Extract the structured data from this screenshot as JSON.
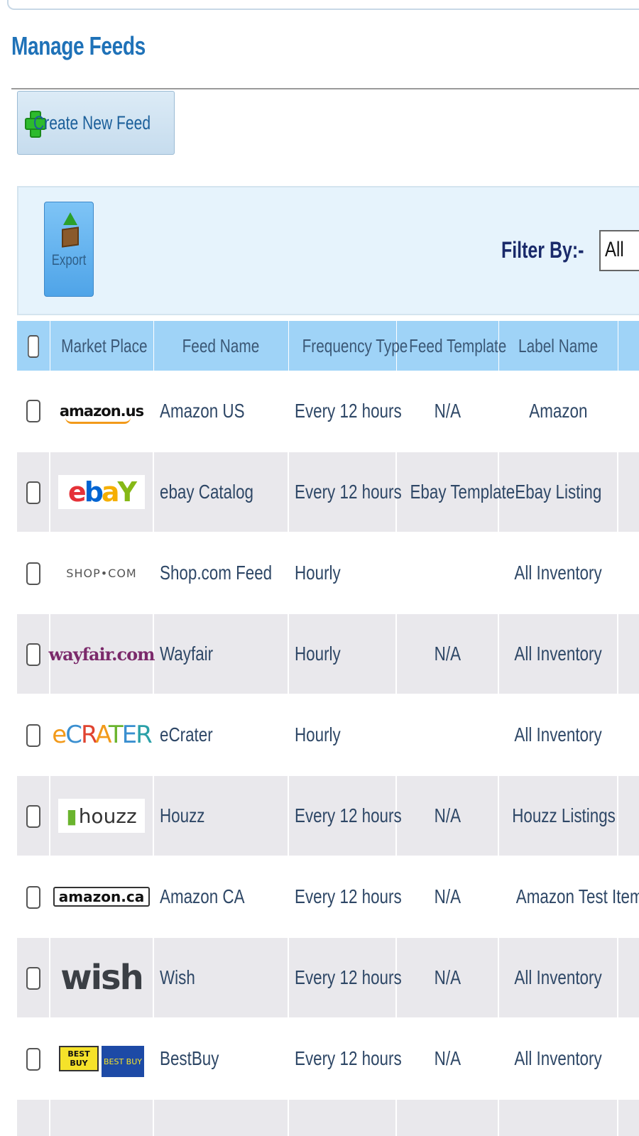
{
  "page": {
    "title": "Manage Feeds"
  },
  "actions": {
    "create_label": "Create New Feed",
    "export_label": "Export"
  },
  "filter": {
    "label": "Filter By:-",
    "value": "All"
  },
  "table": {
    "headers": [
      "Market Place",
      "Feed Name",
      "Frequency Type",
      "Feed Template",
      "Label Name"
    ],
    "rows": [
      {
        "logo": "amazon.us",
        "feed_name": "Amazon US",
        "frequency": "Every 12 hours",
        "template": "N/A",
        "label": "Amazon"
      },
      {
        "logo": "ebY",
        "feed_name": "ebay Catalog",
        "frequency": "Every 12 hours",
        "template": "Ebay Template",
        "label": "Ebay Listing"
      },
      {
        "logo": "SHOP•COM",
        "feed_name": "Shop.com Feed",
        "frequency": "Hourly",
        "template": "",
        "label": "All Inventory"
      },
      {
        "logo": "wayfair.com",
        "feed_name": "Wayfair",
        "frequency": "Hourly",
        "template": "N/A",
        "label": "All Inventory"
      },
      {
        "logo": "eCRATER",
        "feed_name": "eCrater",
        "frequency": "Hourly",
        "template": "",
        "label": "All Inventory"
      },
      {
        "logo": "houzz",
        "feed_name": "Houzz",
        "frequency": "Every 12 hours",
        "template": "N/A",
        "label": "Houzz Listings"
      },
      {
        "logo": "amazon.ca",
        "feed_name": "Amazon CA",
        "frequency": "Every 12 hours",
        "template": "N/A",
        "label": "Amazon Test Items"
      },
      {
        "logo": "wish",
        "feed_name": "Wish",
        "frequency": "Every 12 hours",
        "template": "N/A",
        "label": "All Inventory"
      },
      {
        "logo": "BEST BUY",
        "feed_name": "BestBuy",
        "frequency": "Every 12 hours",
        "template": "N/A",
        "label": "All Inventory"
      }
    ]
  }
}
